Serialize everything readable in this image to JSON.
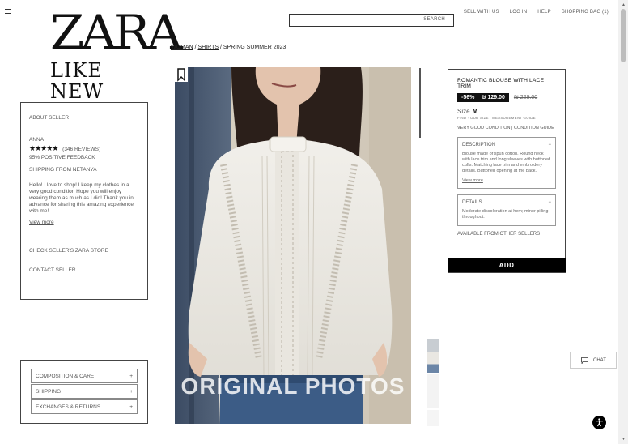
{
  "brand": {
    "logo_line1": "ZARA",
    "logo_line2": "LIKE NEW"
  },
  "search": {
    "label": "SEARCH"
  },
  "nav": {
    "sell": "SELL WITH US",
    "login": "LOG IN",
    "help": "HELP",
    "bag": "SHOPPING BAG (1)"
  },
  "breadcrumb": {
    "level1": "WOMAN",
    "level2": "SHIRTS",
    "level3": "SPRING SUMMER 2023",
    "separator": "/"
  },
  "seller": {
    "about": "ABOUT SELLER",
    "name": "ANNA",
    "rating": 4.5,
    "stars": "★★★★★",
    "reviews": "(346 REVIEWS)",
    "feedback": "95% POSITIVE FEEDBACK",
    "shipping_from": "SHIPPING FROM NETANYA",
    "bio": "Hello! I love to shop! I keep my clothes in a very good condition Hope you will enjoy wearing them as much as I did! Thank you in advance for sharing this amazing experience with me!",
    "view_more": "View more",
    "check_store": "CHECK SELLER'S ZARA STORE",
    "contact": "CONTACT SELLER"
  },
  "info_accordion": [
    {
      "label": "COMPOSITION & CARE",
      "icon": "+"
    },
    {
      "label": "SHIPPING",
      "icon": "+"
    },
    {
      "label": "EXCHANGES & RETURNS",
      "icon": "+"
    }
  ],
  "photo": {
    "overlay_text": "ORIGINAL PHOTOS"
  },
  "product": {
    "name": "ROMANTIC BLOUSE WITH LACE TRIM",
    "discount": "-56%",
    "price": "₪ 129.00",
    "old_price": "₪ 229.00",
    "size_label": "Size",
    "size_value": "M",
    "size_hint": "FIND YOUR SIZE | MEASUREMENT GUIDE",
    "condition": "VERY GOOD CONDITION",
    "condition_guide": "CONDITION GUIDE",
    "description_title": "DESCRIPTION",
    "description": "Blouse made of spun cotton. Round neck with lace trim and long sleeves with buttoned cuffs. Matching lace trim and embroidery details. Buttoned opening at the back.",
    "description_more": "View more",
    "details_title": "DETAILS",
    "details": "Moderate discoloration at hem; minor pilling throughout.",
    "collapse_icon": "−",
    "other_sellers": "AVAILABLE FROM OTHER SELLERS",
    "add_label": "ADD"
  },
  "chat": {
    "label": "CHAT"
  },
  "icons": {
    "hamburger": "hamburger-icon",
    "bookmark": "bookmark-icon",
    "chat": "chat-bubble-icon",
    "accessibility": "accessibility-icon"
  }
}
